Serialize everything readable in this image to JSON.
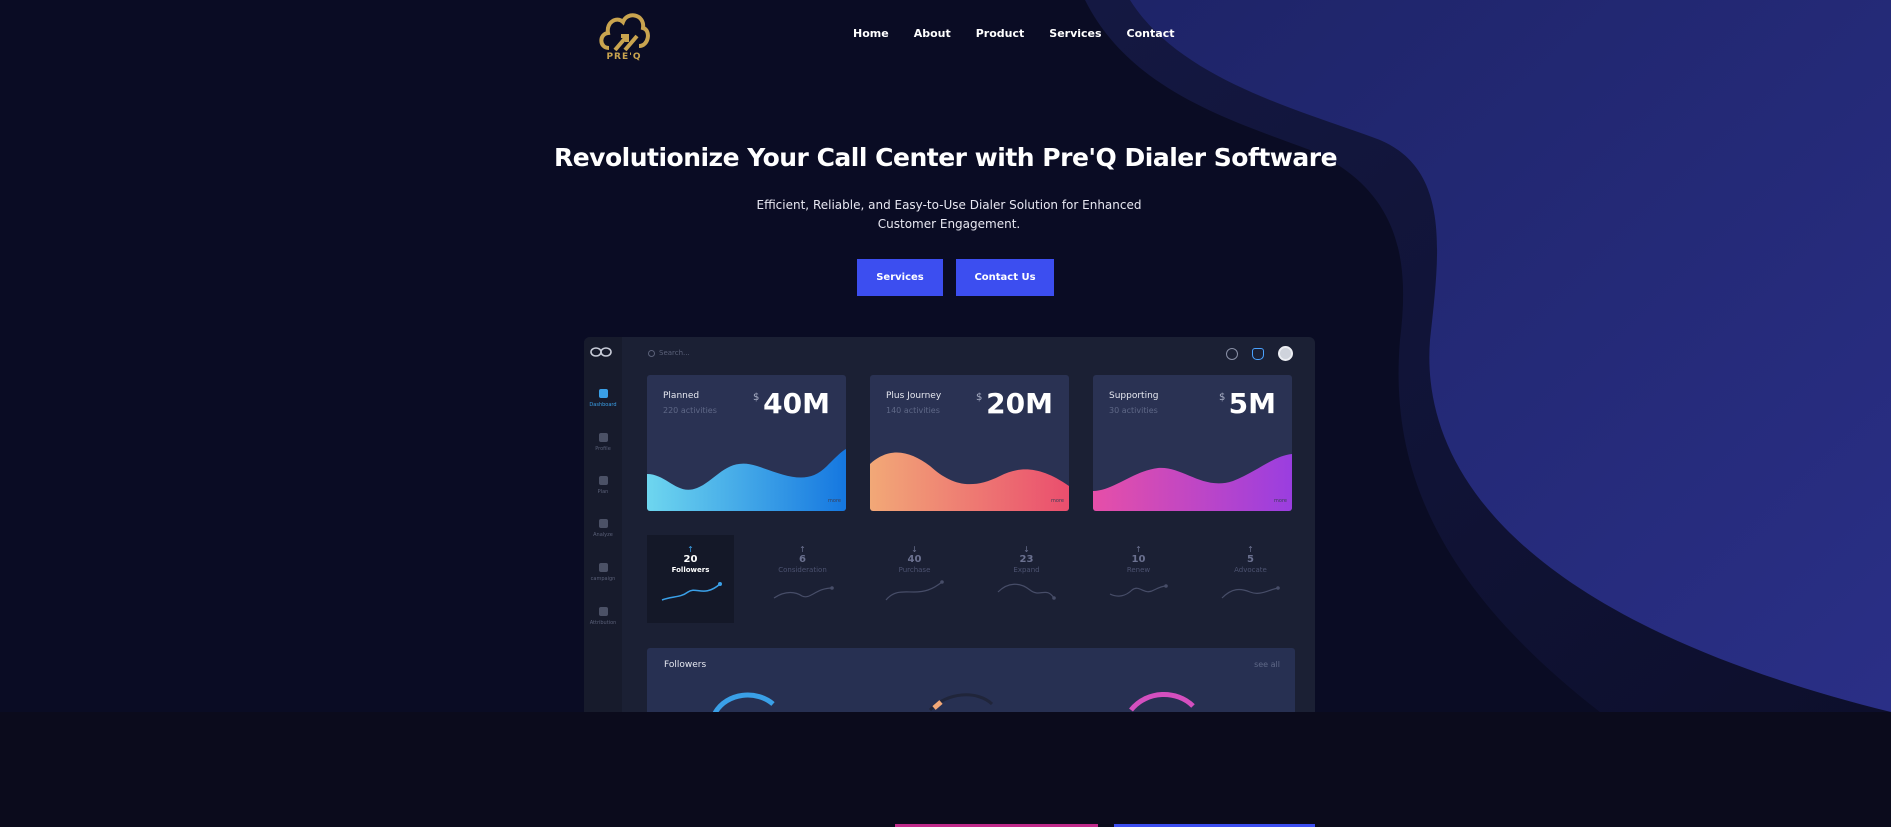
{
  "brand": {
    "name": "PRE'Q",
    "color": "#c9a44f"
  },
  "nav": [
    "Home",
    "About",
    "Product",
    "Services",
    "Contact"
  ],
  "hero": {
    "title": "Revolutionize Your Call Center with Pre'Q Dialer Software",
    "subtitle": "Efficient, Reliable, and Easy-to-Use Dialer Solution for Enhanced Customer Engagement.",
    "buttons": {
      "services": "Services",
      "contact": "Contact Us"
    },
    "accent": "#3c4ef0"
  },
  "dashboard": {
    "search_placeholder": "Search...",
    "sidebar": [
      "Dashboard",
      "Profile",
      "Plan",
      "Analyze",
      "campaign",
      "Attribution"
    ],
    "cards": [
      {
        "title": "Planned",
        "sub": "220 activities",
        "currency": "$",
        "value": "40M",
        "more": "more"
      },
      {
        "title": "Plus Journey",
        "sub": "140 activities",
        "currency": "$",
        "value": "20M",
        "more": "more"
      },
      {
        "title": "Supporting",
        "sub": "30 activities",
        "currency": "$",
        "value": "5M",
        "more": "more"
      }
    ],
    "metrics": [
      {
        "arrow": "↑",
        "value": "20",
        "label": "Followers"
      },
      {
        "arrow": "↑",
        "value": "6",
        "label": "Consideration"
      },
      {
        "arrow": "↓",
        "value": "40",
        "label": "Purchase"
      },
      {
        "arrow": "↓",
        "value": "23",
        "label": "Expand"
      },
      {
        "arrow": "↑",
        "value": "10",
        "label": "Renew"
      },
      {
        "arrow": "↑",
        "value": "5",
        "label": "Advocate"
      }
    ],
    "followers": {
      "title": "Followers",
      "see_all": "see all"
    }
  }
}
